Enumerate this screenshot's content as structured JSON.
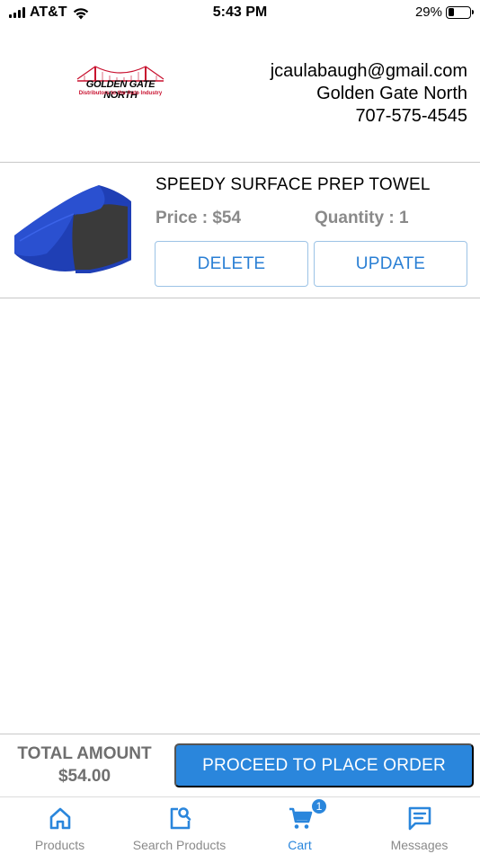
{
  "status_bar": {
    "carrier": "AT&T",
    "time": "5:43 PM",
    "battery_percent": "29%",
    "battery_level": 0.29
  },
  "header": {
    "logo": {
      "title": "GOLDEN GATE NORTH",
      "subtitle": "Distributors to the Auto Industry"
    },
    "contact": {
      "email": "jcaulabaugh@gmail.com",
      "company": "Golden Gate North",
      "phone": "707-575-4545"
    }
  },
  "cart": {
    "items": [
      {
        "title": "SPEEDY SURFACE PREP TOWEL",
        "price_label": "Price : $54",
        "quantity_label": "Quantity : 1",
        "delete_label": "DELETE",
        "update_label": "UPDATE",
        "image_icon": "blue-towel-image"
      }
    ],
    "total_label": "TOTAL AMOUNT",
    "total_value": "$54.00",
    "proceed_label": "PROCEED TO PLACE ORDER"
  },
  "tabbar": {
    "tabs": [
      {
        "label": "Products",
        "icon": "home-icon"
      },
      {
        "label": "Search Products",
        "icon": "search-products-icon"
      },
      {
        "label": "Cart",
        "icon": "cart-icon",
        "badge": "1",
        "active": true
      },
      {
        "label": "Messages",
        "icon": "messages-icon"
      }
    ]
  },
  "colors": {
    "accent": "#2a86dc",
    "muted_text": "#8a8a8a",
    "divider": "#c8c8c8"
  }
}
